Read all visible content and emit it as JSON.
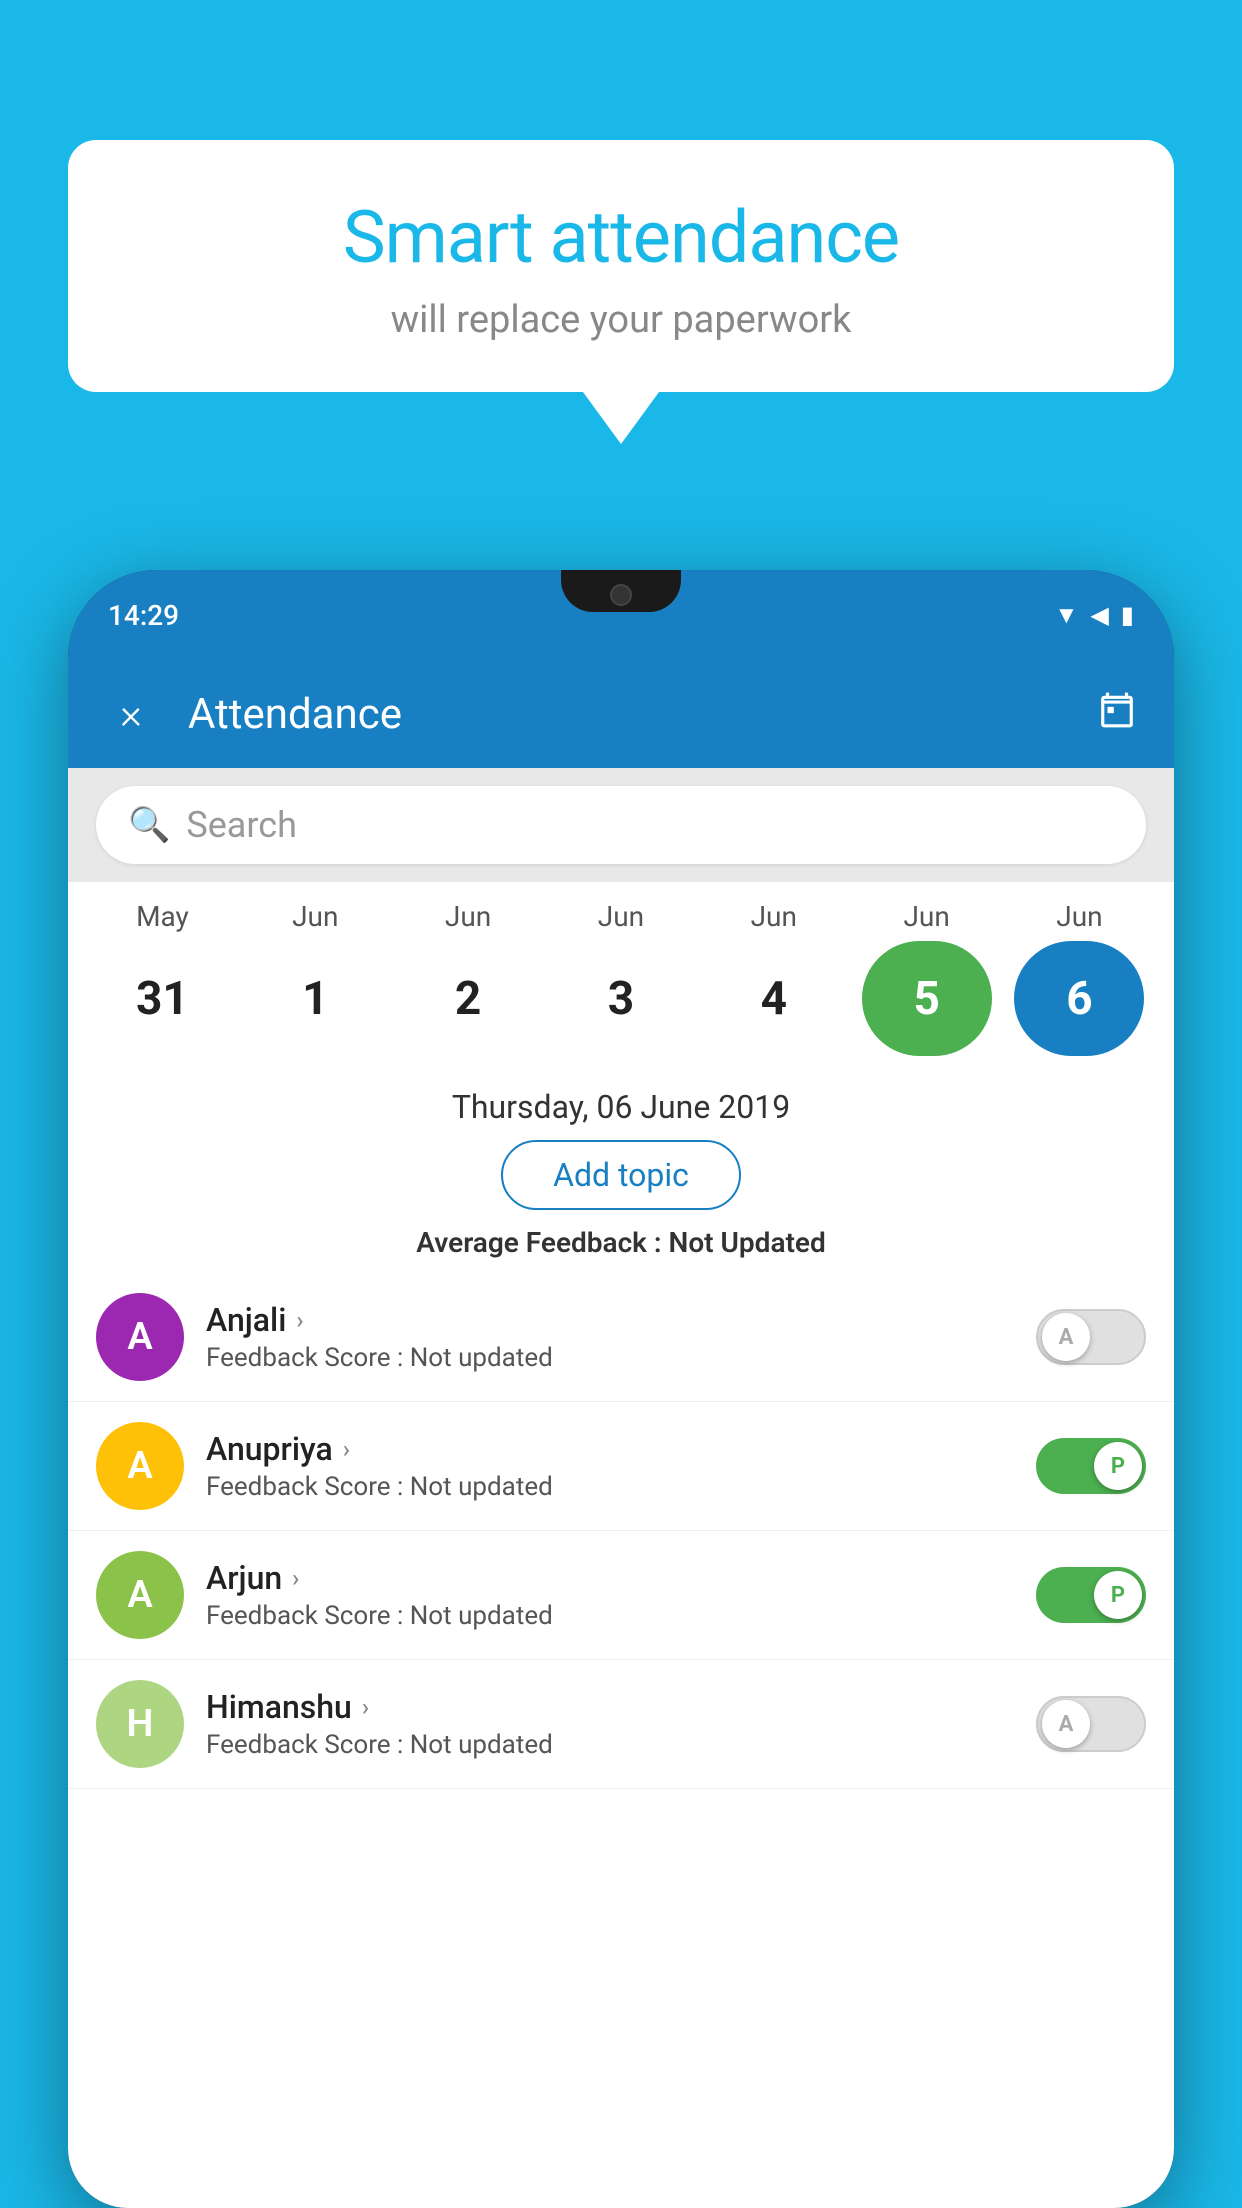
{
  "background_color": "#1ab8e8",
  "speech_bubble": {
    "title": "Smart attendance",
    "subtitle": "will replace your paperwork"
  },
  "status_bar": {
    "time": "14:29",
    "icons": [
      "wifi",
      "signal",
      "battery"
    ]
  },
  "header": {
    "title": "Attendance",
    "close_label": "×"
  },
  "search": {
    "placeholder": "Search"
  },
  "calendar": {
    "months": [
      "May",
      "Jun",
      "Jun",
      "Jun",
      "Jun",
      "Jun",
      "Jun"
    ],
    "days": [
      "31",
      "1",
      "2",
      "3",
      "4",
      "5",
      "6"
    ],
    "selected_green_index": 4,
    "selected_blue_index": 5
  },
  "selected_date": {
    "label": "Thursday, 06 June 2019",
    "add_topic_btn": "Add topic",
    "avg_feedback_label": "Average Feedback : ",
    "avg_feedback_value": "Not Updated"
  },
  "students": [
    {
      "name": "Anjali",
      "avatar_letter": "A",
      "avatar_color": "#9c27b0",
      "feedback_label": "Feedback Score : ",
      "feedback_value": "Not updated",
      "attendance": "absent"
    },
    {
      "name": "Anupriya",
      "avatar_letter": "A",
      "avatar_color": "#ffc107",
      "feedback_label": "Feedback Score : ",
      "feedback_value": "Not updated",
      "attendance": "present"
    },
    {
      "name": "Arjun",
      "avatar_letter": "A",
      "avatar_color": "#8bc34a",
      "feedback_label": "Feedback Score : ",
      "feedback_value": "Not updated",
      "attendance": "present"
    },
    {
      "name": "Himanshu",
      "avatar_letter": "H",
      "avatar_color": "#aed581",
      "feedback_label": "Feedback Score : ",
      "feedback_value": "Not updated",
      "attendance": "absent"
    }
  ]
}
